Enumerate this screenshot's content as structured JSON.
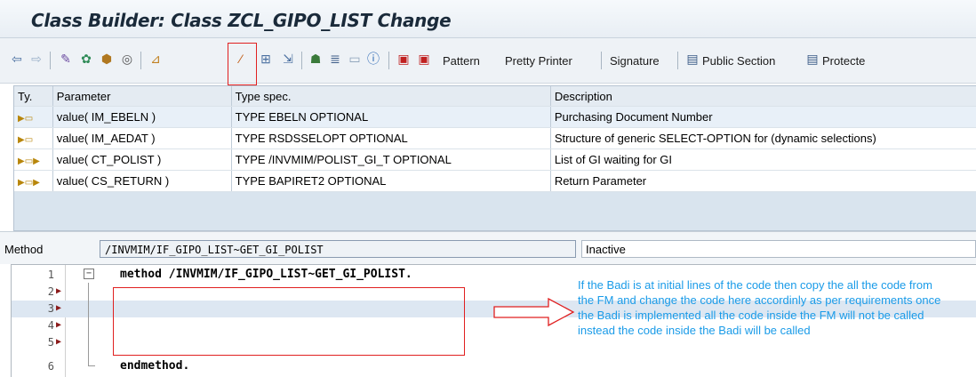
{
  "window": {
    "title": "Class Builder: Class ZCL_GIPO_LIST Change"
  },
  "toolbar": {
    "icons": [
      "back-icon",
      "forward-icon",
      "other-object-icon",
      "display-change-icon",
      "activate-icon",
      "where-used-icon",
      "check-icon",
      "enhance-icon",
      "magic-wand-icon",
      "edit-icon",
      "transport-icon",
      "hierarchy-icon",
      "align-icon",
      "blank-icon",
      "info-icon",
      "breakpoint-icon",
      "external-breakpoint-icon"
    ],
    "pattern_label": "Pattern",
    "pretty_printer_label": "Pretty Printer",
    "signature_label": "Signature",
    "public_section_label": "Public Section",
    "protected_section_label": "Protecte"
  },
  "parameters": {
    "headers": {
      "type": "Ty.",
      "parameter": "Parameter",
      "type_spec": "Type spec.",
      "description": "Description"
    },
    "rows": [
      {
        "icon": "▶▭",
        "parameter": "value( IM_EBELN )",
        "type_spec": "TYPE EBELN OPTIONAL",
        "description": "Purchasing Document Number"
      },
      {
        "icon": "▶▭",
        "parameter": "value( IM_AEDAT )",
        "type_spec": "TYPE RSDSSELOPT OPTIONAL",
        "description": "Structure of generic SELECT-OPTION for (dynamic selections)"
      },
      {
        "icon": "▶▭▶",
        "parameter": "value( CT_POLIST )",
        "type_spec": "TYPE /INVMIM/POLIST_GI_T OPTIONAL",
        "description": "List of GI waiting for GI"
      },
      {
        "icon": "▶▭▶",
        "parameter": "value( CS_RETURN )",
        "type_spec": "TYPE BAPIRET2 OPTIONAL",
        "description": "Return Parameter"
      }
    ]
  },
  "method": {
    "label": "Method",
    "name": "/INVMIM/IF_GIPO_LIST~GET_GI_POLIST",
    "status": "Inactive"
  },
  "editor": {
    "lines": [
      {
        "num": "1",
        "code": "method /INVMIM/IF_GIPO_LIST~GET_GI_POLIST."
      },
      {
        "num": "2",
        "code": ""
      },
      {
        "num": "3",
        "code": ""
      },
      {
        "num": "4",
        "code": ""
      },
      {
        "num": "5",
        "code": ""
      },
      {
        "num": "6",
        "code": "endmethod."
      }
    ]
  },
  "annotation": {
    "note": "If the Badi is at initial lines of the code then copy the all the code from the FM and change the code here accordinly as per requirements once the Badi is implemented all the code inside the FM will not be called instead the code inside the Badi will be called"
  },
  "colors": {
    "note": "#1a9be8",
    "highlight": "#e02020",
    "current_line": "#dde7f2"
  }
}
